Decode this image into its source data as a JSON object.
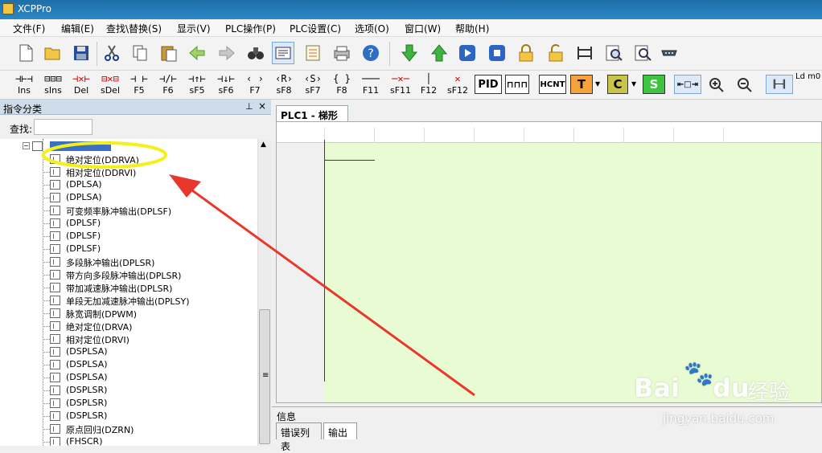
{
  "window": {
    "title": "XCPPro"
  },
  "menu": [
    "文件(F)",
    "编辑(E)",
    "查找\\替换(S)",
    "显示(V)",
    "PLC操作(P)",
    "PLC设置(C)",
    "选项(O)",
    "窗口(W)",
    "帮助(H)"
  ],
  "ladder_toolbar": [
    {
      "label": "Ins",
      "icon": "ins-row-icon"
    },
    {
      "label": "sIns",
      "icon": "sins-row-icon"
    },
    {
      "label": "Del",
      "icon": "del-row-icon"
    },
    {
      "label": "sDel",
      "icon": "sdel-row-icon"
    },
    {
      "label": "F5",
      "icon": "contact-no-icon"
    },
    {
      "label": "F6",
      "icon": "contact-nc-icon"
    },
    {
      "label": "sF5",
      "icon": "contact-rise-icon"
    },
    {
      "label": "sF6",
      "icon": "contact-fall-icon"
    },
    {
      "label": "F7",
      "icon": "coil-icon"
    },
    {
      "label": "sF8",
      "icon": "reset-coil-icon"
    },
    {
      "label": "sF7",
      "icon": "set-coil-icon"
    },
    {
      "label": "F8",
      "icon": "instruction-icon"
    },
    {
      "label": "F11",
      "icon": "hline-icon"
    },
    {
      "label": "sF11",
      "icon": "del-hline-icon"
    },
    {
      "label": "F12",
      "icon": "vline-icon"
    },
    {
      "label": "sF12",
      "icon": "del-vline-icon"
    }
  ],
  "special_buttons": {
    "pid": "PID",
    "hcnt": "HCNT",
    "t": "T",
    "c": "C",
    "s": "S",
    "ld_label": "Ld m0"
  },
  "left_panel": {
    "title": "指令分类",
    "pin": "ꟻ",
    "close": "×",
    "search_label": "查找:",
    "search_value": ""
  },
  "tree": {
    "items": [
      "绝对定位(DDRVA)",
      "相对定位(DDRVI)",
      "(DPLSA)",
      "(DPLSA)",
      "可变频率脉冲输出(DPLSF)",
      "(DPLSF)",
      "(DPLSF)",
      "(DPLSF)",
      "多段脉冲输出(DPLSR)",
      "带方向多段脉冲输出(DPLSR)",
      "带加减速脉冲输出(DPLSR)",
      "单段无加减速脉冲输出(DPLSY)",
      "脉宽调制(DPWM)",
      "绝对定位(DRVA)",
      "相对定位(DRVI)",
      "(DSPLSA)",
      "(DSPLSA)",
      "(DSPLSA)",
      "(DSPLSR)",
      "(DSPLSR)",
      "(DSPLSR)",
      "原点回归(DZRN)",
      "(FHSCR)"
    ]
  },
  "editor": {
    "tab": "PLC1 - 梯形图"
  },
  "info": {
    "title": "信息",
    "tabs": [
      "错误列表",
      "输出"
    ]
  },
  "watermark": {
    "brand": "Bai",
    "brand2": "du",
    "cn": "经验",
    "url": "jingyan.baidu.com"
  },
  "colors": {
    "ladder_bg": "#e8fbd2",
    "rail": "#7a1a5e",
    "annotation_yellow": "#f5ef1a",
    "annotation_red": "#e8382c"
  }
}
